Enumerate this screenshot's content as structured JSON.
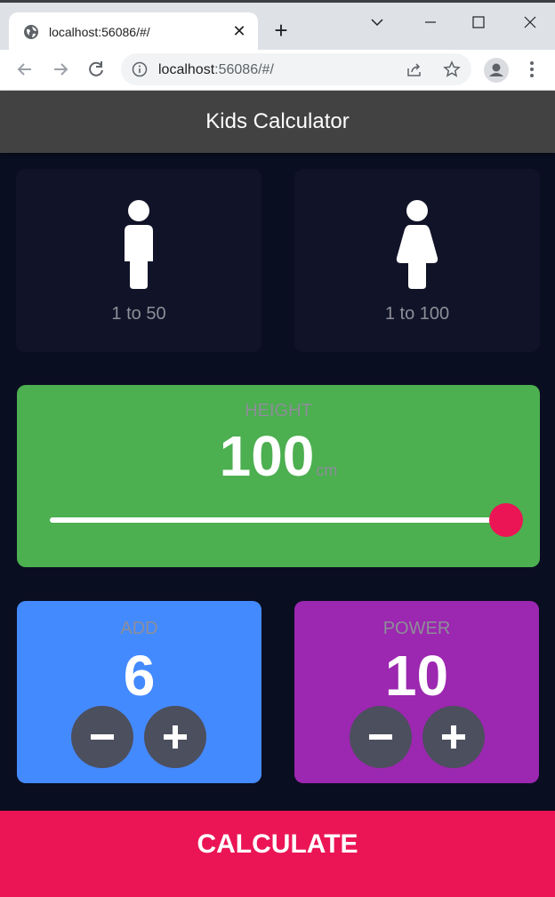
{
  "browser": {
    "tab_title": "localhost:56086/#/",
    "url_host": "localhost",
    "url_path": ":56086/#/",
    "icons": [
      "globe-icon",
      "close-icon",
      "plus-icon",
      "chevron-down-icon",
      "minimize-icon",
      "maximize-icon",
      "close-window-icon",
      "back-icon",
      "forward-icon",
      "reload-icon",
      "info-icon",
      "share-icon",
      "star-icon",
      "profile-icon",
      "more-vert-icon"
    ]
  },
  "app": {
    "title": "Kids Calculator",
    "colors": {
      "background": "#0a0e21",
      "inactive_card": "#111328",
      "height_card": "#4caf50",
      "add_card": "#448aff",
      "power_card": "#9c27b0",
      "accent": "#eb1555",
      "round_button": "#4c4f5e",
      "label": "#8d8e98",
      "app_bar": "#424242"
    }
  },
  "gender_cards": [
    {
      "label": "1 to 50",
      "icon": "male-icon"
    },
    {
      "label": "1 to 100",
      "icon": "female-icon"
    }
  ],
  "height": {
    "label": "HEIGHT",
    "value": "100",
    "unit": "cm",
    "slider_fraction": 1.0
  },
  "add": {
    "label": "ADD",
    "value": "6",
    "minus_icon": "minus-icon",
    "plus_icon": "plus-icon"
  },
  "power": {
    "label": "POWER",
    "value": "10",
    "minus_icon": "minus-icon",
    "plus_icon": "plus-icon"
  },
  "calculate": {
    "label": "CALCULATE"
  }
}
